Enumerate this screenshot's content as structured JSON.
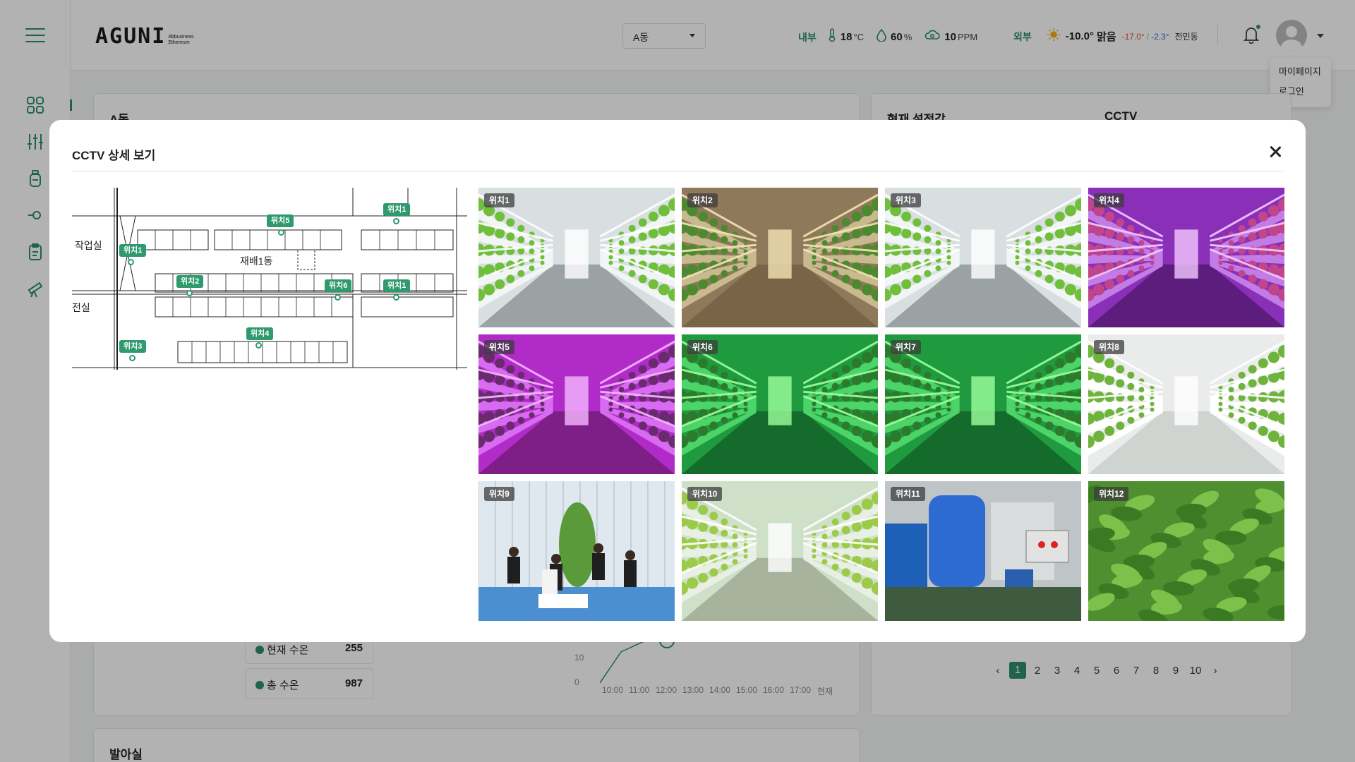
{
  "header": {
    "logo_main": "AGUNI",
    "logo_sub": "Abbusiness Ethereum",
    "building_select": "A동",
    "indoor_label": "내부",
    "indoor_temp": "18",
    "indoor_temp_unit": "°C",
    "indoor_humidity": "60",
    "indoor_humidity_unit": "%",
    "indoor_co2": "10",
    "indoor_co2_unit": "PPM",
    "outdoor_label": "외부",
    "outdoor_temp": "-10.0°",
    "outdoor_weather": "맑음",
    "outdoor_low": "-17.0°",
    "outdoor_sep": "/",
    "outdoor_high": "-2.3°",
    "outdoor_location": "전민동"
  },
  "user_menu": {
    "items": [
      "마이페이지",
      "로그인"
    ]
  },
  "background": {
    "card_a_title": "A동",
    "card_settings_title": "현재 설정값",
    "card_cctv_title": "CCTV",
    "card_nursery_title": "발아실",
    "legend": [
      {
        "label": "현재 수온",
        "value": "255"
      },
      {
        "label": "총 수온",
        "value": "987"
      }
    ],
    "y_ticks": [
      "10",
      "0"
    ],
    "x_ticks": [
      "10:00",
      "11:00",
      "12:00",
      "13:00",
      "14:00",
      "15:00",
      "16:00",
      "17:00",
      "현재"
    ],
    "pagination": [
      "1",
      "2",
      "3",
      "4",
      "5",
      "6",
      "7",
      "8",
      "9",
      "10"
    ],
    "active_page": "1"
  },
  "modal": {
    "title": "CCTV 상세 보기",
    "floorplan": {
      "rooms": [
        "작업실",
        "재배1동",
        "전실"
      ],
      "tags": [
        "위치1",
        "위치2",
        "위치3",
        "위치4",
        "위치5",
        "위치6",
        "위치1",
        "위치1"
      ]
    },
    "cameras": [
      {
        "label": "위치1",
        "scene": "white-shelves"
      },
      {
        "label": "위치2",
        "scene": "warm-corridor"
      },
      {
        "label": "위치3",
        "scene": "white-shelves"
      },
      {
        "label": "위치4",
        "scene": "purple-shelves"
      },
      {
        "label": "위치5",
        "scene": "magenta-greenhouse"
      },
      {
        "label": "위치6",
        "scene": "green-shelves"
      },
      {
        "label": "위치7",
        "scene": "green-shelves"
      },
      {
        "label": "위치8",
        "scene": "white-racks"
      },
      {
        "label": "위치9",
        "scene": "greenhouse-people"
      },
      {
        "label": "위치10",
        "scene": "hydroponic-rows"
      },
      {
        "label": "위치11",
        "scene": "tank-machine"
      },
      {
        "label": "위치12",
        "scene": "leafy-field"
      }
    ]
  },
  "colors": {
    "accent": "#2f8f6e",
    "tag": "#2f9a6e"
  }
}
